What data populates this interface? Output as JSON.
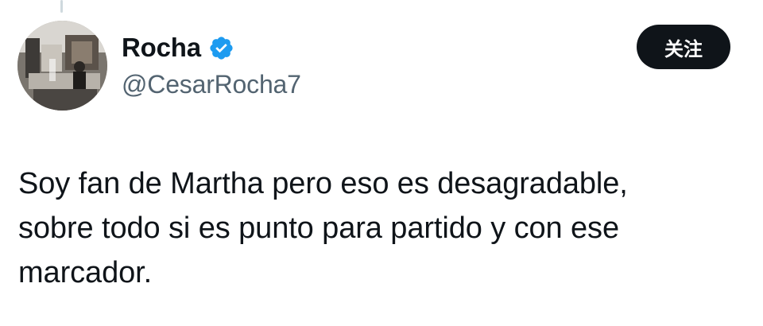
{
  "author": {
    "display_name": "Rocha",
    "handle": "@CesarRocha7",
    "verified": true,
    "verified_badge_color": "#1d9bf0",
    "avatar_icon": "profile-photo"
  },
  "actions": {
    "follow_label": "关注"
  },
  "tweet": {
    "text": "Soy fan de Martha pero eso es desagradable,\nsobre todo si es punto para partido y con ese\nmarcador."
  },
  "colors": {
    "text_primary": "#0f1419",
    "text_secondary": "#536471",
    "button_bg": "#0f1419",
    "button_text": "#ffffff",
    "thread_line": "#cfd9de"
  }
}
